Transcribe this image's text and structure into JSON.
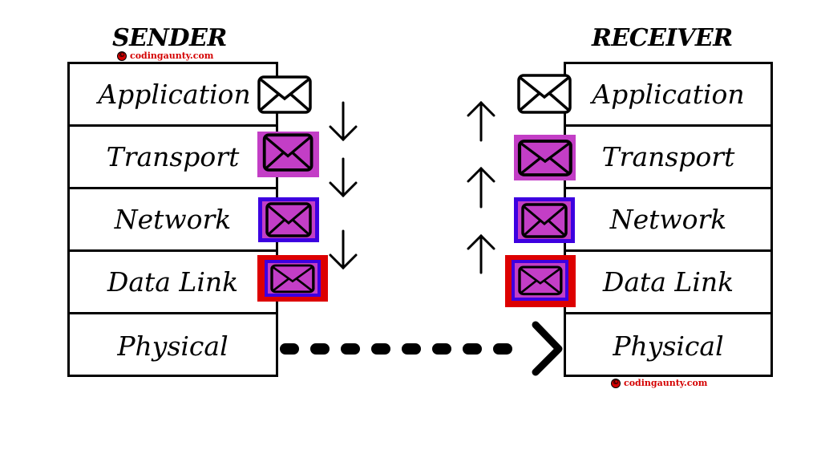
{
  "sender": {
    "title": "SENDER",
    "layers": [
      "Application",
      "Transport",
      "Network",
      "Data Link",
      "Physical"
    ]
  },
  "receiver": {
    "title": "RECEIVER",
    "layers": [
      "Application",
      "Transport",
      "Network",
      "Data Link",
      "Physical"
    ]
  },
  "watermark": {
    "symbol": "©",
    "text": "codingaunty.com"
  },
  "envelopes": [
    {
      "layer": "Application",
      "icon": "envelope-icon",
      "fill": "#ffffff",
      "wrappers": []
    },
    {
      "layer": "Transport",
      "icon": "envelope-icon",
      "fill": "#c33ec6",
      "wrappers": [
        "#c33ec6"
      ]
    },
    {
      "layer": "Network",
      "icon": "envelope-icon",
      "fill": "#c33ec6",
      "wrappers": [
        "#3d00e0"
      ]
    },
    {
      "layer": "Data Link",
      "icon": "envelope-icon",
      "fill": "#c33ec6",
      "wrappers": [
        "#dd0000",
        "#3d00e0"
      ]
    }
  ],
  "colors": {
    "transport_header": "#c33ec6",
    "network_header": "#3d00e0",
    "datalink_header": "#dd0000",
    "watermark": "#d40000"
  },
  "arrows": {
    "sender_direction": "down",
    "receiver_direction": "up",
    "physical_link": "dotted-arrow-right"
  }
}
